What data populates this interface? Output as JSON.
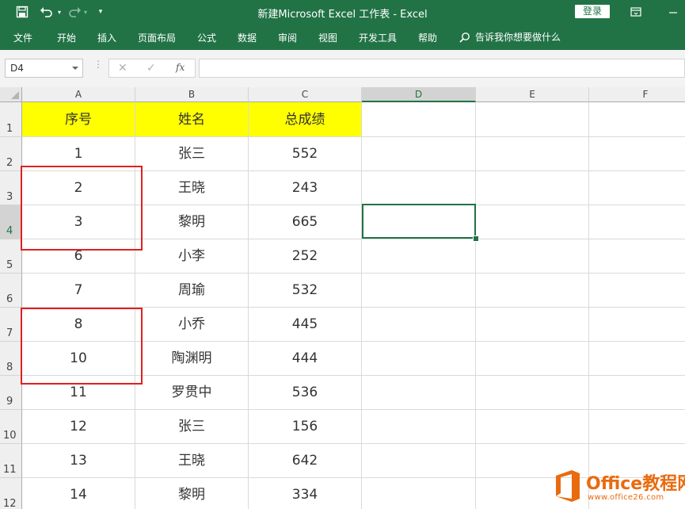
{
  "window": {
    "title": "新建Microsoft Excel 工作表  -  Excel",
    "login_label": "登录"
  },
  "ribbon": {
    "tabs": [
      "文件",
      "开始",
      "插入",
      "页面布局",
      "公式",
      "数据",
      "审阅",
      "视图",
      "开发工具",
      "帮助"
    ],
    "tell_me": "告诉我你想要做什么"
  },
  "formula_bar": {
    "name_box": "D4",
    "fx_label": "fx",
    "formula": ""
  },
  "sheet": {
    "column_headers": [
      "A",
      "B",
      "C",
      "D",
      "E",
      "F"
    ],
    "row_headers": [
      "1",
      "2",
      "3",
      "4",
      "5",
      "6",
      "7",
      "8",
      "9",
      "10",
      "11",
      "12"
    ],
    "header_row": [
      "序号",
      "姓名",
      "总成绩"
    ],
    "rows": [
      [
        "1",
        "张三",
        "552"
      ],
      [
        "2",
        "王晓",
        "243"
      ],
      [
        "3",
        "黎明",
        "665"
      ],
      [
        "6",
        "小李",
        "252"
      ],
      [
        "7",
        "周瑜",
        "532"
      ],
      [
        "8",
        "小乔",
        "445"
      ],
      [
        "10",
        "陶渊明",
        "444"
      ],
      [
        "11",
        "罗贯中",
        "536"
      ],
      [
        "12",
        "张三",
        "156"
      ],
      [
        "13",
        "王晓",
        "642"
      ],
      [
        "14",
        "黎明",
        "334"
      ]
    ],
    "selected_cell": "D4",
    "header_fill_color": "#ffff00",
    "highlight_color": "#e02020"
  },
  "watermark": {
    "title": "Office教程网",
    "url": "www.office26.com"
  },
  "colors": {
    "brand": "#217346"
  }
}
